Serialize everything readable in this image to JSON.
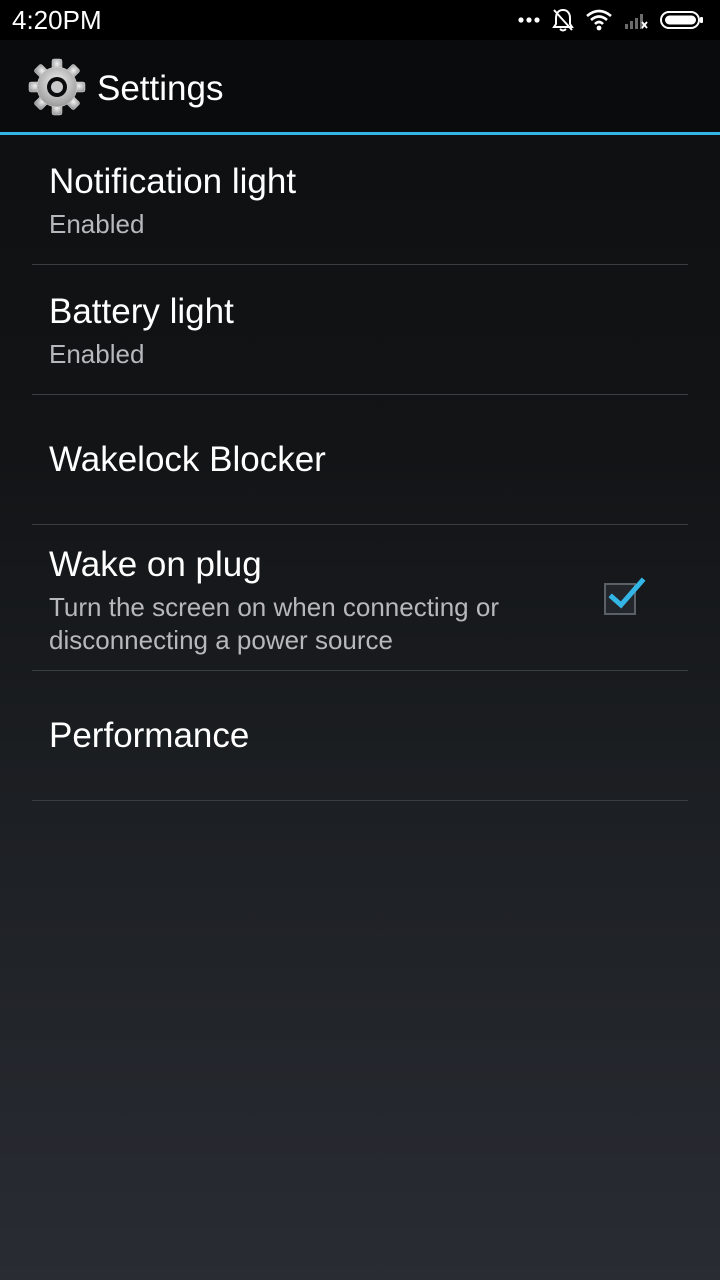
{
  "status_bar": {
    "time": "4:20PM",
    "icons": [
      "more-dots-icon",
      "bell-muted-icon",
      "wifi-icon",
      "cell-signal-no-service-icon",
      "battery-icon"
    ]
  },
  "action_bar": {
    "icon": "gear-icon",
    "title": "Settings",
    "accent_color": "#33b5e5"
  },
  "preferences": [
    {
      "title": "Notification light",
      "summary": "Enabled"
    },
    {
      "title": "Battery light",
      "summary": "Enabled"
    },
    {
      "title": "Wakelock Blocker",
      "summary": ""
    },
    {
      "title": "Wake on plug",
      "summary": "Turn the screen on when connecting or disconnecting a power source",
      "checked": true
    },
    {
      "title": "Performance",
      "summary": ""
    }
  ]
}
